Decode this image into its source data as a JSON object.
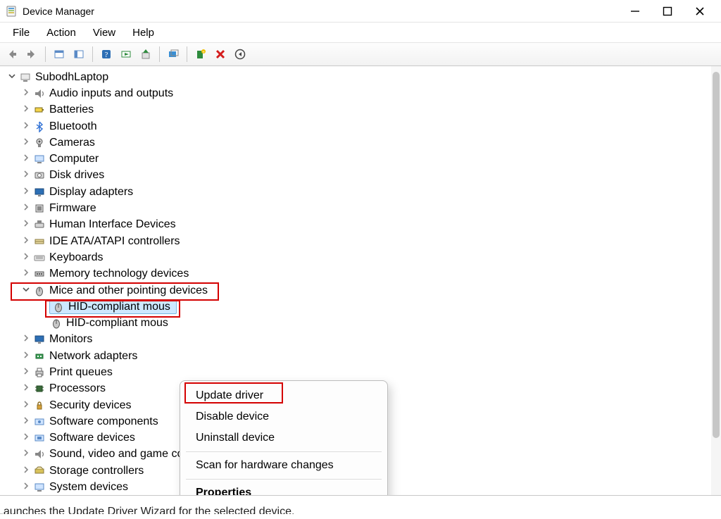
{
  "window": {
    "title": "Device Manager"
  },
  "menu": {
    "file": "File",
    "action": "Action",
    "view": "View",
    "help": "Help"
  },
  "toolbar_icons": {
    "back": "back-arrow-icon",
    "forward": "forward-arrow-icon",
    "props": "properties-icon",
    "details": "details-pane-icon",
    "help": "help-icon",
    "scan": "scan-hardware-icon",
    "update": "update-driver-icon",
    "show": "show-hidden-icon",
    "add": "add-legacy-icon",
    "delete": "delete-icon",
    "enable": "enable-device-icon"
  },
  "tree": {
    "root": "SubodhLaptop",
    "items": [
      "Audio inputs and outputs",
      "Batteries",
      "Bluetooth",
      "Cameras",
      "Computer",
      "Disk drives",
      "Display adapters",
      "Firmware",
      "Human Interface Devices",
      "IDE ATA/ATAPI controllers",
      "Keyboards",
      "Memory technology devices",
      "Mice and other pointing devices",
      "Monitors",
      "Network adapters",
      "Print queues",
      "Processors",
      "Security devices",
      "Software components",
      "Software devices",
      "Sound, video and game controllers",
      "Storage controllers",
      "System devices"
    ],
    "mice_children": [
      "HID-compliant mouse",
      "HID-compliant mouse"
    ],
    "mice_child_display_trunc": "HID-compliant mous"
  },
  "context_menu": {
    "update": "Update driver",
    "disable": "Disable device",
    "uninstall": "Uninstall device",
    "scan": "Scan for hardware changes",
    "properties": "Properties"
  },
  "status": "Launches the Update Driver Wizard for the selected device."
}
